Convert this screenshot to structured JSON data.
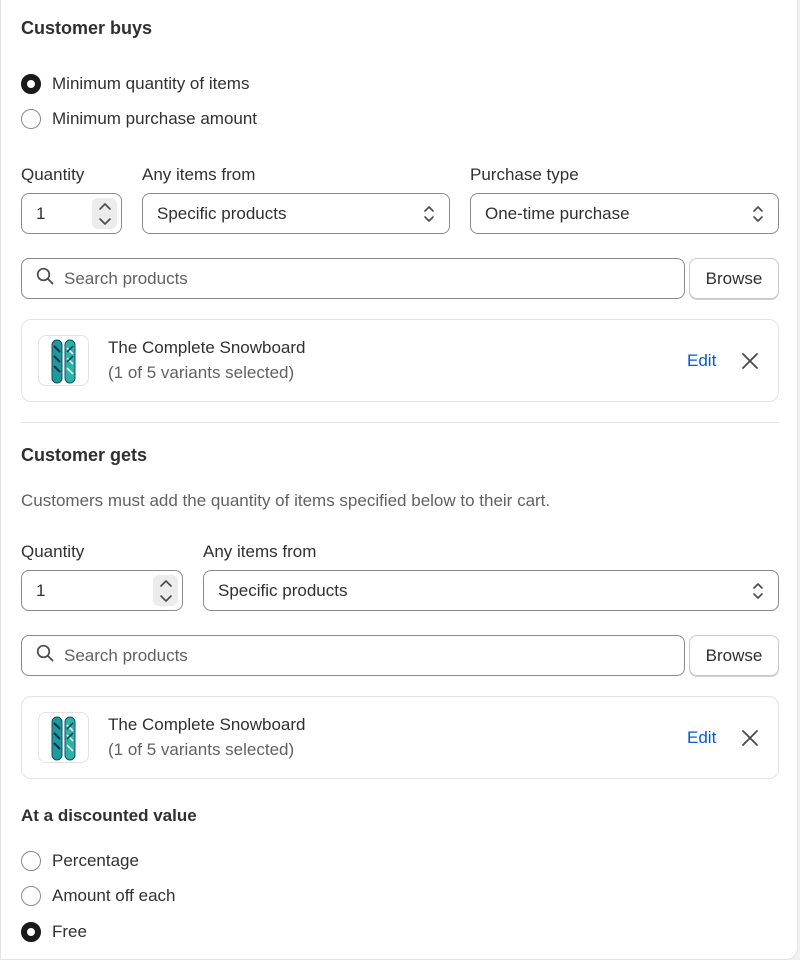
{
  "customer_buys": {
    "title": "Customer buys",
    "options": [
      {
        "label": "Minimum quantity of items",
        "checked": true
      },
      {
        "label": "Minimum purchase amount",
        "checked": false
      }
    ],
    "quantity_label": "Quantity",
    "quantity_value": "1",
    "items_from_label": "Any items from",
    "items_from_value": "Specific products",
    "purchase_type_label": "Purchase type",
    "purchase_type_value": "One-time purchase",
    "search_placeholder": "Search products",
    "browse_label": "Browse",
    "product": {
      "name": "The Complete Snowboard",
      "variants": "(1 of 5 variants selected)",
      "edit_label": "Edit"
    }
  },
  "customer_gets": {
    "title": "Customer gets",
    "description": "Customers must add the quantity of items specified below to their cart.",
    "quantity_label": "Quantity",
    "quantity_value": "1",
    "items_from_label": "Any items from",
    "items_from_value": "Specific products",
    "search_placeholder": "Search products",
    "browse_label": "Browse",
    "product": {
      "name": "The Complete Snowboard",
      "variants": "(1 of 5 variants selected)",
      "edit_label": "Edit"
    }
  },
  "discounted_value": {
    "title": "At a discounted value",
    "options": [
      {
        "label": "Percentage",
        "checked": false
      },
      {
        "label": "Amount off each",
        "checked": false
      },
      {
        "label": "Free",
        "checked": true
      }
    ]
  },
  "colors": {
    "link": "#005bd3",
    "text": "#303030",
    "muted": "#616161",
    "border": "#8a8a8a"
  },
  "icons": {
    "search": "search-icon",
    "close": "close-icon",
    "select": "select-arrows-icon",
    "stepper": "stepper-icon"
  }
}
